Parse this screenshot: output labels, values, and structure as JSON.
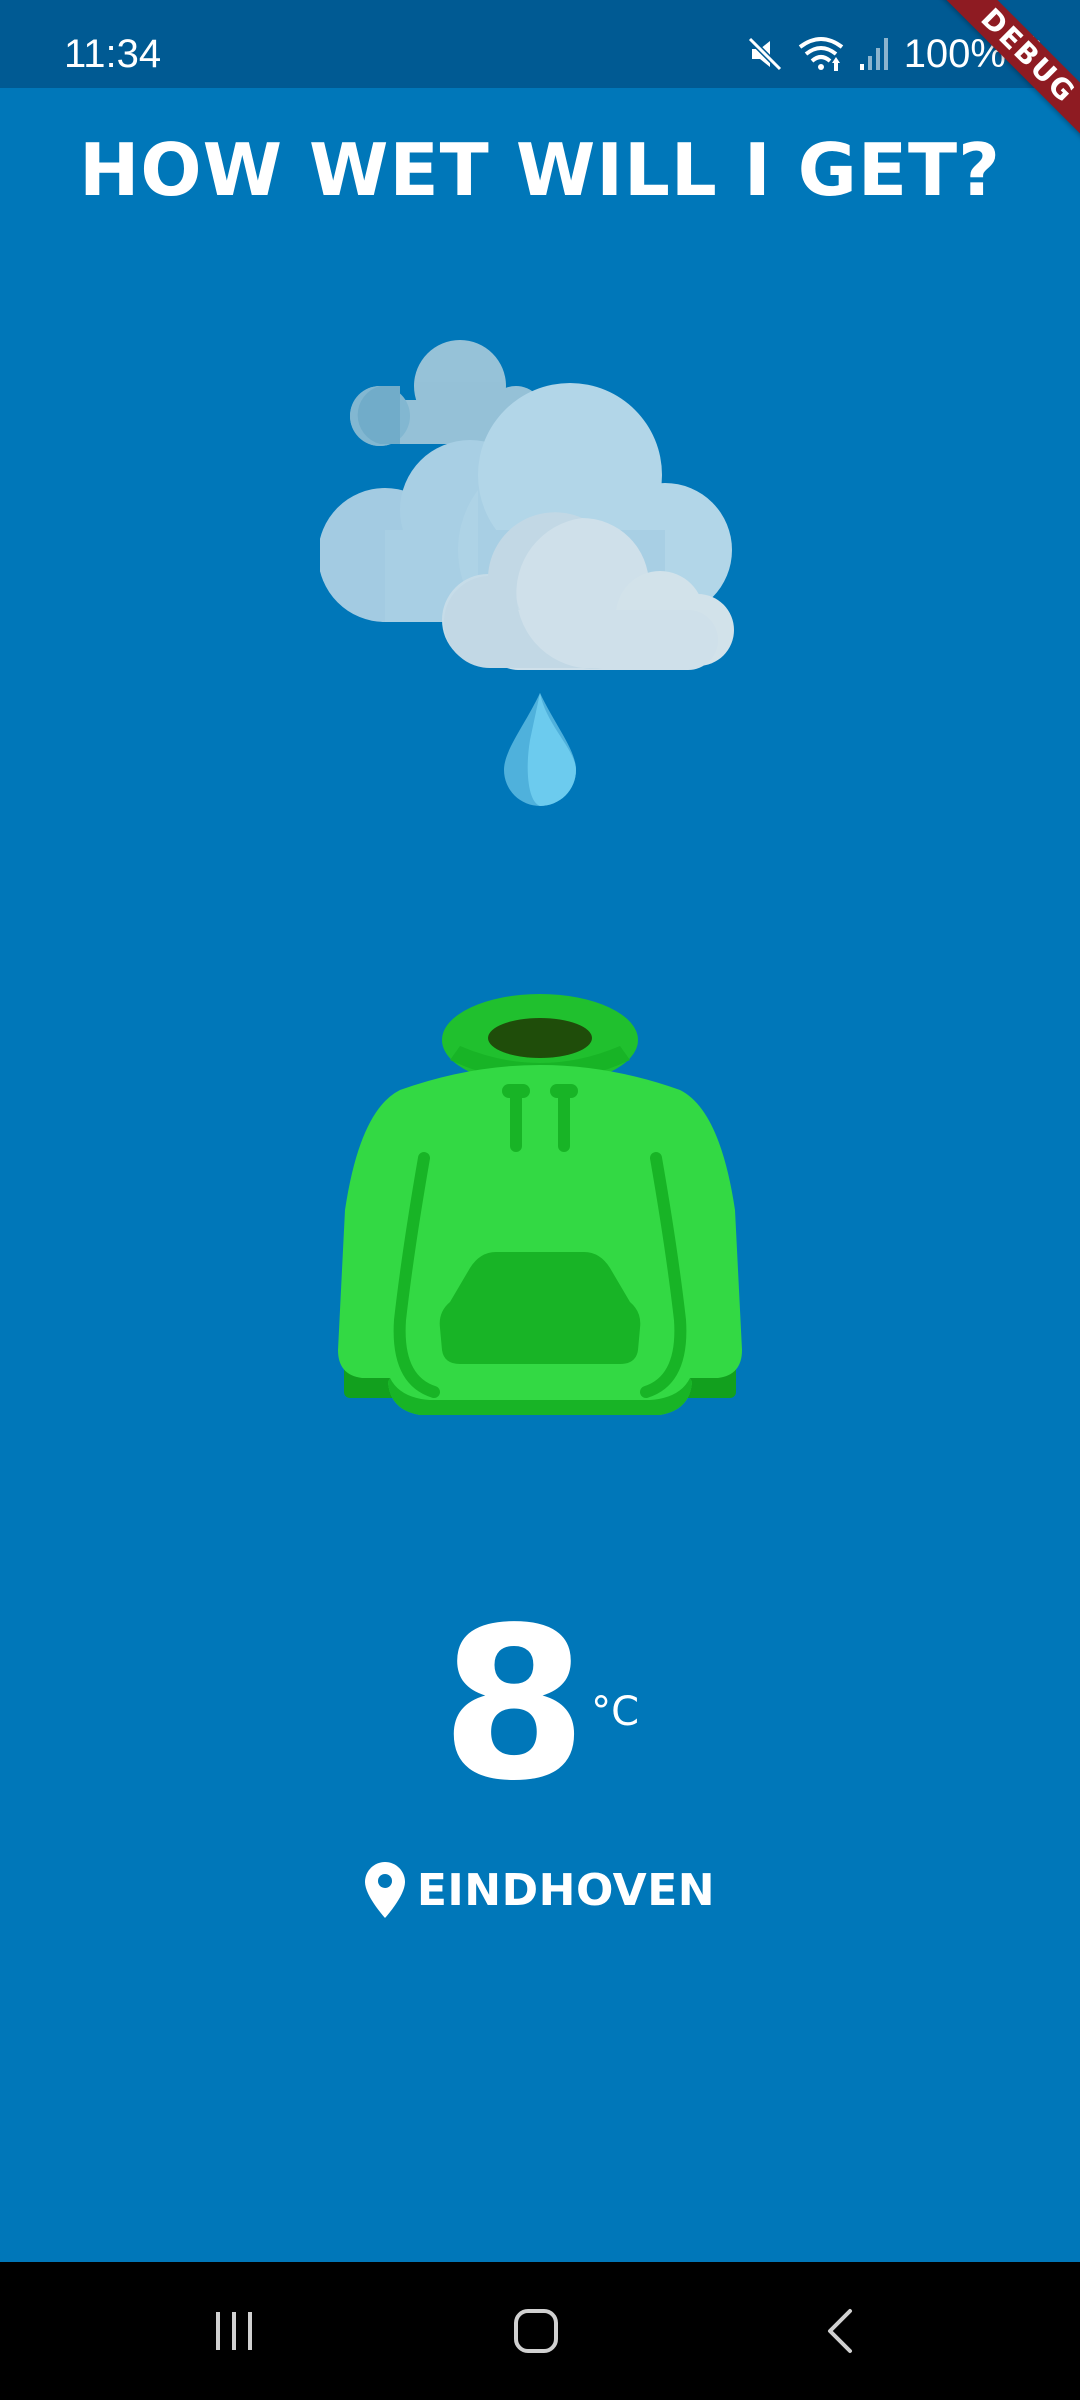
{
  "status_bar": {
    "time": "11:34",
    "battery": "100%",
    "icons": [
      "mute-icon",
      "wifi-icon",
      "signal-icon",
      "battery-icon"
    ]
  },
  "debug_banner": "DEBUG",
  "title": "HOW WET WILL I GET?",
  "weather": {
    "icon": "cloud-rain-icon"
  },
  "clothing": {
    "icon": "hoodie-icon"
  },
  "temperature": {
    "value": "8",
    "unit": "°C"
  },
  "location": {
    "icon": "location-pin-icon",
    "name": "EINDHOVEN"
  },
  "nav_bar": {
    "buttons": [
      "recent-apps-icon",
      "home-icon",
      "back-icon"
    ]
  },
  "colors": {
    "background": "#0077b9",
    "status_bar": "#005a93",
    "hoodie": "#33d944",
    "hoodie_dark": "#18b426",
    "debug_ribbon": "#8e1b22"
  }
}
